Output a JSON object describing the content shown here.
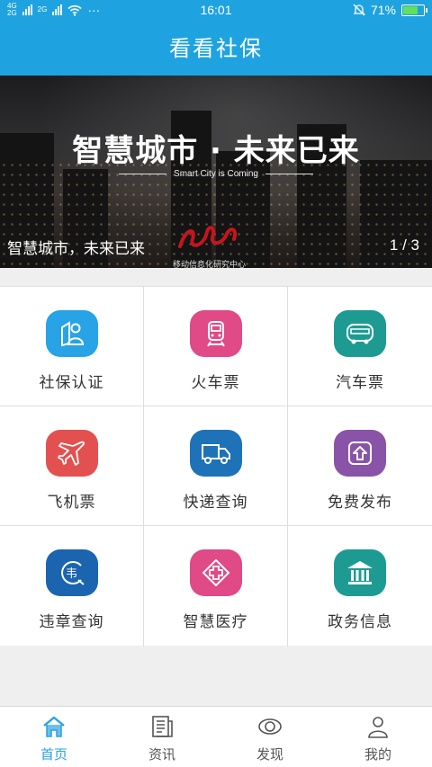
{
  "status_bar": {
    "network_1": "4G",
    "network_2": "2G",
    "network_3": "2G",
    "more": "···",
    "time": "16:01",
    "battery": "71%",
    "battery_level": 0.71
  },
  "title": "看看社保",
  "banner": {
    "headline": "智慧城市 · 未来已来",
    "subtitle": "Smart City is Coming",
    "caption": "智慧城市，未来已来",
    "org": "移动信息化研究中心",
    "pager": "1 / 3"
  },
  "services": [
    {
      "label": "社保认证",
      "icon": "social-security-icon",
      "color": "#27a3e6"
    },
    {
      "label": "火车票",
      "icon": "train-icon",
      "color": "#e04a86"
    },
    {
      "label": "汽车票",
      "icon": "bus-icon",
      "color": "#1d9b93"
    },
    {
      "label": "飞机票",
      "icon": "airplane-icon",
      "color": "#e2514f"
    },
    {
      "label": "快递查询",
      "icon": "truck-icon",
      "color": "#1e72b8"
    },
    {
      "label": "免费发布",
      "icon": "upload-icon",
      "color": "#8954a8"
    },
    {
      "label": "违章查询",
      "icon": "violation-icon",
      "color": "#1b64b0"
    },
    {
      "label": "智慧医疗",
      "icon": "medical-icon",
      "color": "#e04a86"
    },
    {
      "label": "政务信息",
      "icon": "government-icon",
      "color": "#1d9b93"
    }
  ],
  "tabs": [
    {
      "label": "首页",
      "icon": "home-icon",
      "active": true
    },
    {
      "label": "资讯",
      "icon": "news-icon",
      "active": false
    },
    {
      "label": "发现",
      "icon": "eye-icon",
      "active": false
    },
    {
      "label": "我的",
      "icon": "user-icon",
      "active": false
    }
  ],
  "colors": {
    "primary": "#1fa3e0",
    "tab_active": "#2aa1e0"
  }
}
